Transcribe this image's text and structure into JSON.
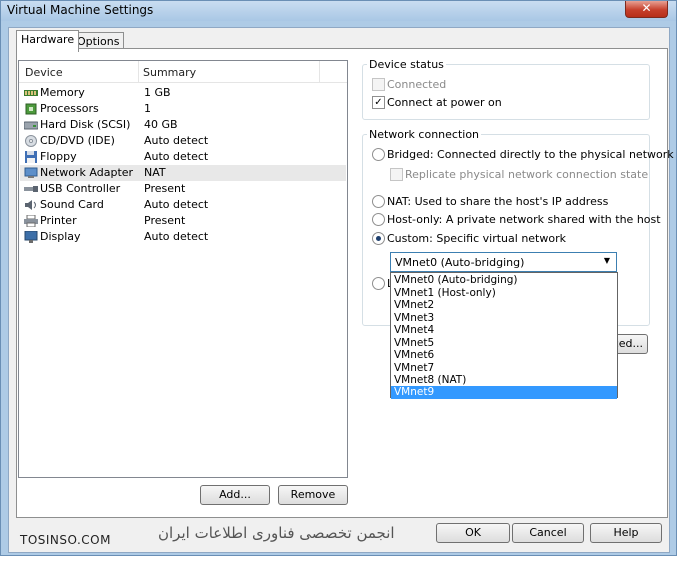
{
  "window": {
    "title": "Virtual Machine Settings",
    "close_glyph": "✕"
  },
  "tabs": [
    {
      "label": "Hardware",
      "active": true
    },
    {
      "label": "Options",
      "active": false
    }
  ],
  "device_list": {
    "columns": [
      "Device",
      "Summary"
    ],
    "rows": [
      {
        "name": "Memory",
        "summary": "1 GB",
        "icon": "memory-icon"
      },
      {
        "name": "Processors",
        "summary": "1",
        "icon": "processor-icon"
      },
      {
        "name": "Hard Disk (SCSI)",
        "summary": "40 GB",
        "icon": "hard-disk-icon"
      },
      {
        "name": "CD/DVD (IDE)",
        "summary": "Auto detect",
        "icon": "cd-dvd-icon"
      },
      {
        "name": "Floppy",
        "summary": "Auto detect",
        "icon": "floppy-icon"
      },
      {
        "name": "Network Adapter",
        "summary": "NAT",
        "icon": "network-adapter-icon",
        "selected": true
      },
      {
        "name": "USB Controller",
        "summary": "Present",
        "icon": "usb-icon"
      },
      {
        "name": "Sound Card",
        "summary": "Auto detect",
        "icon": "sound-card-icon"
      },
      {
        "name": "Printer",
        "summary": "Present",
        "icon": "printer-icon"
      },
      {
        "name": "Display",
        "summary": "Auto detect",
        "icon": "display-icon"
      }
    ]
  },
  "buttons": {
    "add": "Add...",
    "remove": "Remove",
    "advanced_partial": "ced...",
    "ok_partial": "OK",
    "cancel": "Cancel",
    "help": "Help"
  },
  "device_status": {
    "title": "Device status",
    "connected": {
      "label": "Connected",
      "checked": false,
      "enabled": false
    },
    "connect_at_power_on": {
      "label": "Connect at power on",
      "checked": true,
      "enabled": true
    }
  },
  "network_connection": {
    "title": "Network connection",
    "bridged": {
      "label": "Bridged: Connected directly to the physical network",
      "checked": false
    },
    "replicate": {
      "label": "Replicate physical network connection state",
      "checked": false,
      "enabled": false
    },
    "nat": {
      "label": "NAT: Used to share the host's IP address",
      "checked": false
    },
    "host_only": {
      "label": "Host-only: A private network shared with the host",
      "checked": false
    },
    "custom": {
      "label": "Custom: Specific virtual network",
      "checked": true
    },
    "lan_segment_partial": "L",
    "select": {
      "value": "VMnet0 (Auto-bridging)",
      "options": [
        "VMnet0 (Auto-bridging)",
        "VMnet1 (Host-only)",
        "VMnet2",
        "VMnet3",
        "VMnet4",
        "VMnet5",
        "VMnet6",
        "VMnet7",
        "VMnet8 (NAT)",
        "VMnet9"
      ],
      "highlighted": "VMnet9"
    }
  },
  "watermark": {
    "left": "TOSINSO.COM",
    "right": "انجمن تخصصی فناوری اطلاعات ایران"
  }
}
